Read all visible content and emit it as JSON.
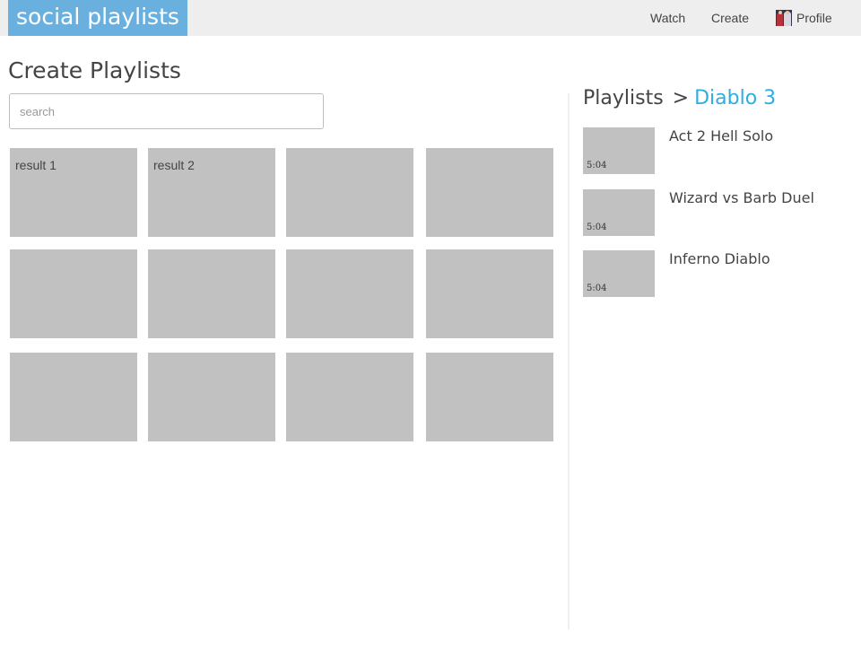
{
  "header": {
    "brand": "social playlists",
    "nav": {
      "watch": "Watch",
      "create": "Create",
      "profile": "Profile"
    }
  },
  "main": {
    "title": "Create Playlists",
    "search": {
      "placeholder": "search",
      "value": ""
    },
    "results": [
      {
        "label": "result 1"
      },
      {
        "label": "result 2"
      },
      {
        "label": ""
      },
      {
        "label": ""
      },
      {
        "label": ""
      },
      {
        "label": ""
      },
      {
        "label": ""
      },
      {
        "label": ""
      },
      {
        "label": ""
      },
      {
        "label": ""
      },
      {
        "label": ""
      },
      {
        "label": ""
      }
    ]
  },
  "sidebar": {
    "breadcrumb": {
      "root": "Playlists",
      "separator": ">",
      "current": "Diablo 3"
    },
    "items": [
      {
        "title": "Act 2 Hell Solo",
        "duration": "5:04"
      },
      {
        "title": "Wizard vs Barb Duel",
        "duration": "5:04"
      },
      {
        "title": "Inferno Diablo",
        "duration": "5:04"
      }
    ]
  },
  "colors": {
    "brand_bg": "#6ab0df",
    "accent": "#2baee5",
    "tile": "#c1c1c1",
    "topbar": "#eeeeee"
  }
}
